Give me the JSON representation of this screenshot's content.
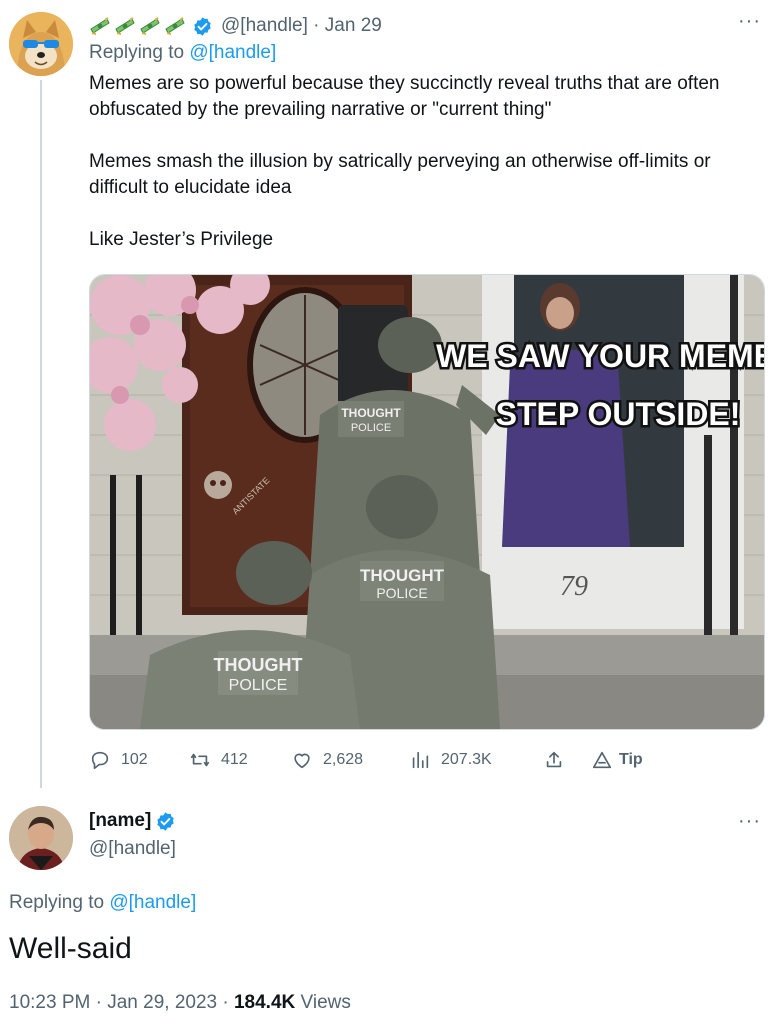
{
  "reply_tweet": {
    "display_name": "",
    "handle": "@[handle]",
    "date": "Jan 29",
    "replying_prefix": "Replying to",
    "replying_to": "@[handle]",
    "paragraphs": [
      "Memes are so powerful because they succinctly reveal truths that are often obfuscated by the prevailing narrative or \"current thing\"",
      "Memes smash the illusion by satrically perveying an otherwise off-limits or difficult to elucidate idea",
      "Like Jester’s Privilege"
    ],
    "meme": {
      "caption_line1": "WE SAW YOUR MEME,",
      "caption_line2": "STEP OUTSIDE!",
      "vest_line1": "THOUGHT",
      "vest_line2": "POLICE",
      "door_number": "79",
      "watermark": "ANTISTATE"
    },
    "actions": {
      "replies": "102",
      "retweets": "412",
      "likes": "2,628",
      "views": "207.3K",
      "tip": "Tip"
    },
    "more": "···"
  },
  "main_tweet": {
    "display_name": "[name]",
    "handle": "@[handle]",
    "replying_prefix": "Replying to",
    "replying_to": "@[handle]",
    "text": "Well-said",
    "time": "10:23 PM",
    "date": "Jan 29, 2023",
    "views_count": "184.4K",
    "views_label": "Views",
    "more": "···"
  },
  "colors": {
    "accent": "#1d9bf0",
    "secondary_text": "#536471",
    "primary_text": "#0f1419",
    "thread_line": "#cfd9de"
  },
  "icons": [
    "verified-badge-icon",
    "reply-icon",
    "retweet-icon",
    "like-icon",
    "views-icon",
    "share-icon",
    "tip-icon",
    "more-icon",
    "money-emoji-icon"
  ]
}
